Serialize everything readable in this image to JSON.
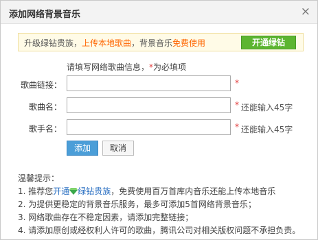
{
  "dialog": {
    "title": "添加网络背景音乐",
    "close_glyph": "×"
  },
  "promo": {
    "text_1": "升级绿钻贵族，",
    "text_2": "上传本地歌曲",
    "text_3": "，背景音乐",
    "text_4": "免费使用",
    "button_label": "开通绿钻"
  },
  "form": {
    "hint_1": "请填写网络歌曲信息，",
    "hint_star": "*",
    "hint_2": "为必填项",
    "song_link_label": "歌曲链接：",
    "song_link_value": "",
    "song_name_label": "歌曲名：",
    "song_name_value": "",
    "song_name_remain": "还能输入45字",
    "singer_label": "歌手名：",
    "singer_value": "",
    "singer_remain": "还能输入45字",
    "required_mark": "*",
    "add_label": "添加",
    "cancel_label": "取消"
  },
  "tips": {
    "heading": "温馨提示：",
    "line1_a": "1. 推荐您",
    "line1_link": "开通",
    "line1_link2": "绿钻贵族",
    "line1_b": "，免费使用百万首库内音乐还能上传本地音乐",
    "line2": "2. 为提供更稳定的背景音乐服务，最多可添加5首网络背景音乐；",
    "line3": "3. 网络歌曲存在不稳定因素，请添加完整链接；",
    "line4": "4. 请添加原创或经权利人许可的歌曲，腾讯公司对相关版权问题不承担负责。"
  },
  "colors": {
    "accent_green": "#5cb531",
    "accent_blue": "#4b9ed8",
    "required_red": "#e23b3b",
    "highlight_orange": "#ff6600"
  }
}
